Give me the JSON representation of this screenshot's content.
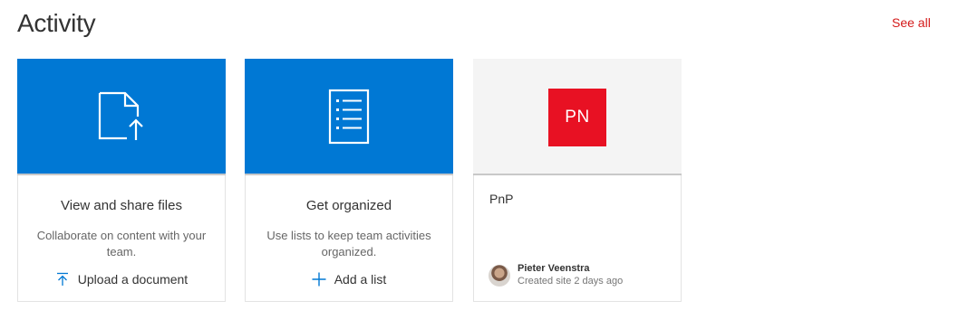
{
  "header": {
    "title": "Activity",
    "see_all": "See all"
  },
  "cards": [
    {
      "title": "View and share files",
      "description": "Collaborate on content with your team.",
      "action_label": "Upload a document",
      "hero_icon": "document-upload-icon",
      "action_icon": "upload-arrow-icon"
    },
    {
      "title": "Get organized",
      "description": "Use lists to keep team activities organized.",
      "action_label": "Add a list",
      "hero_icon": "list-document-icon",
      "action_icon": "plus-icon"
    },
    {
      "site_logo_text": "PN",
      "site_name": "PnP",
      "author": "Pieter Veenstra",
      "author_meta": "Created site 2 days ago"
    }
  ],
  "colors": {
    "accent": "#0078d4",
    "link": "#d41a1a",
    "site_logo": "#e81123"
  }
}
